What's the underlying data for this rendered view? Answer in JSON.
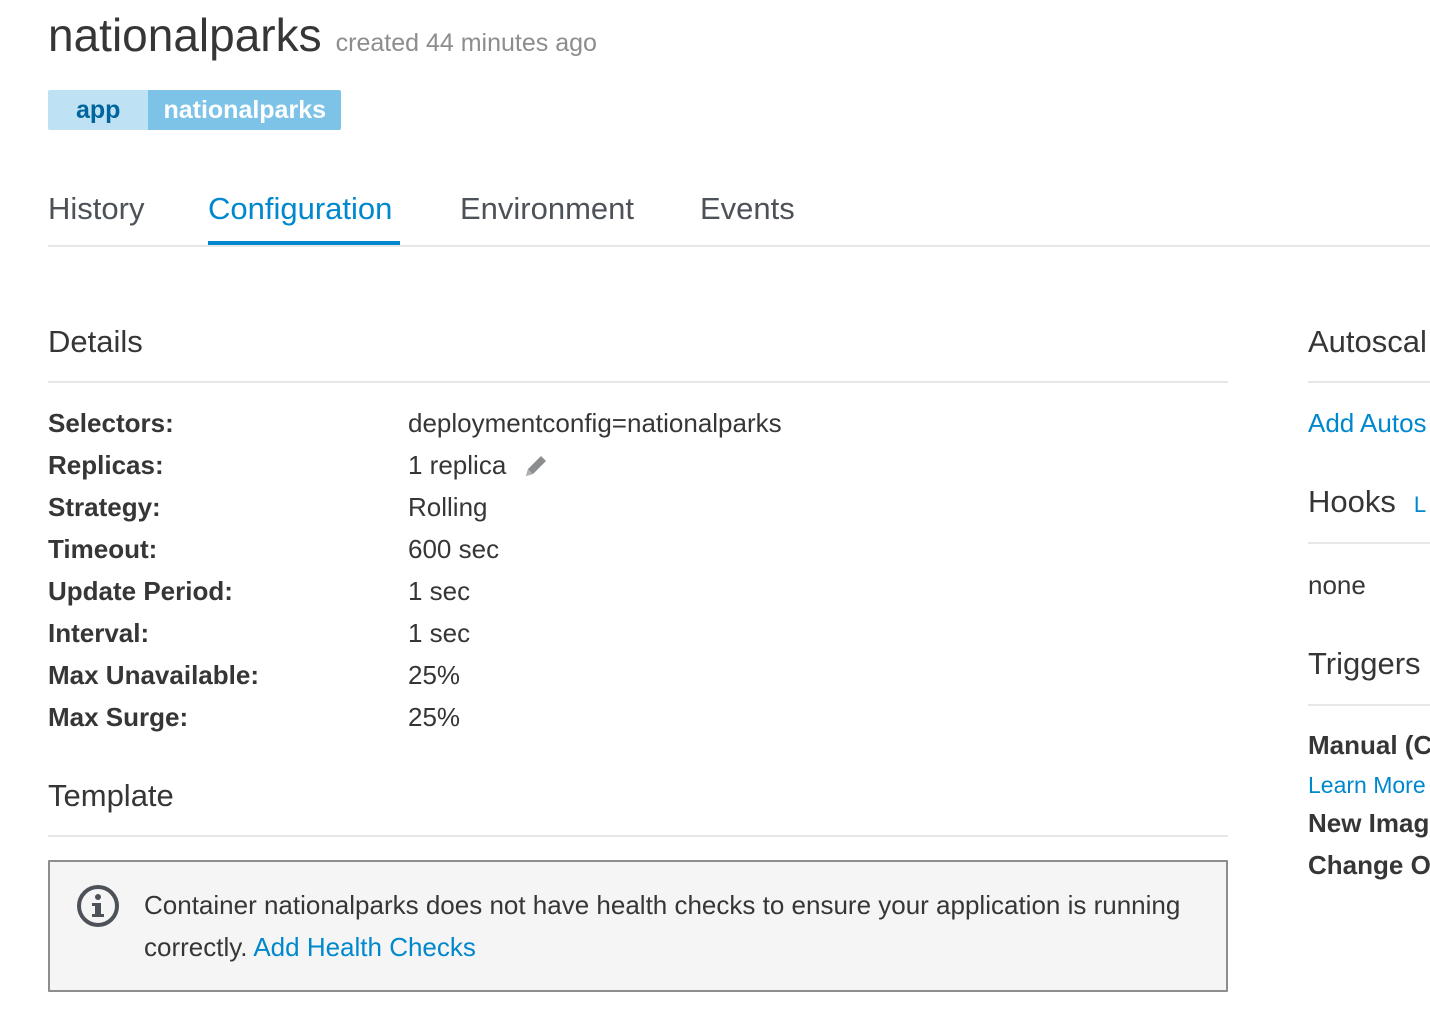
{
  "header": {
    "title": "nationalparks",
    "created": "created 44 minutes ago"
  },
  "labels": [
    {
      "key": "app",
      "value": "nationalparks"
    }
  ],
  "tabs": [
    {
      "label": "History",
      "active": false
    },
    {
      "label": "Configuration",
      "active": true
    },
    {
      "label": "Environment",
      "active": false
    },
    {
      "label": "Events",
      "active": false
    }
  ],
  "details": {
    "title": "Details",
    "rows": [
      {
        "term": "Selectors:",
        "value": "deploymentconfig=nationalparks"
      },
      {
        "term": "Replicas:",
        "value": "1 replica"
      },
      {
        "term": "Strategy:",
        "value": "Rolling"
      },
      {
        "term": "Timeout:",
        "value": "600 sec"
      },
      {
        "term": "Update Period:",
        "value": "1 sec"
      },
      {
        "term": "Interval:",
        "value": "1 sec"
      },
      {
        "term": "Max Unavailable:",
        "value": "25%"
      },
      {
        "term": "Max Surge:",
        "value": "25%"
      }
    ],
    "edit_icon": "pencil-icon"
  },
  "template": {
    "title": "Template",
    "alert": {
      "icon": "info-circle-icon",
      "text": "Container nationalparks does not have health checks to ensure your application is running correctly.",
      "link": "Add Health Checks"
    }
  },
  "sidebar": {
    "autoscaler_title": "Autoscal",
    "autoscaler_link": "Add Autos",
    "hooks_title": "Hooks",
    "hooks_link": "L",
    "hooks_value": "none",
    "triggers_title": "Triggers",
    "trigger_manual": "Manual (C",
    "learn_more": "Learn More",
    "trigger_image": "New Imag",
    "trigger_config": "Change O"
  },
  "colors": {
    "accent": "#0088ce",
    "label_key_bg": "#bee1f4",
    "label_value_bg": "#7dc3e8",
    "text": "#363636",
    "muted": "#8b8d8f"
  }
}
